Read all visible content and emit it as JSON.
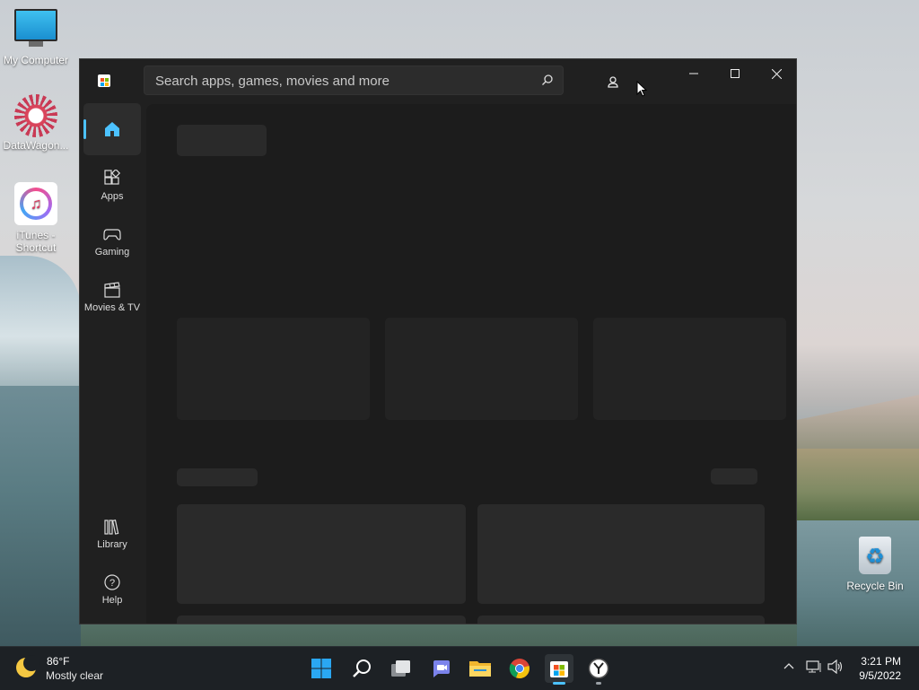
{
  "desktop": {
    "icons": [
      {
        "label": "My Computer",
        "icon": "monitor-icon"
      },
      {
        "label": "DataWagon...",
        "icon": "datawagon-icon"
      },
      {
        "label": "iTunes - Shortcut",
        "icon": "itunes-icon"
      },
      {
        "label": "Recycle Bin",
        "icon": "recycle-bin-icon"
      }
    ]
  },
  "store": {
    "search": {
      "placeholder": "Search apps, games, movies and more"
    },
    "nav": [
      {
        "label": "Home",
        "icon": "home-icon",
        "active": true
      },
      {
        "label": "Apps",
        "icon": "apps-icon"
      },
      {
        "label": "Gaming",
        "icon": "gamepad-icon"
      },
      {
        "label": "Movies & TV",
        "icon": "clapperboard-icon"
      },
      {
        "label": "Library",
        "icon": "library-icon"
      },
      {
        "label": "Help",
        "icon": "help-icon"
      }
    ],
    "accent": "#4cc2ff"
  },
  "taskbar": {
    "weather": {
      "temp": "86°F",
      "condition": "Mostly clear"
    },
    "clock": {
      "time": "3:21 PM",
      "date": "9/5/2022"
    }
  }
}
